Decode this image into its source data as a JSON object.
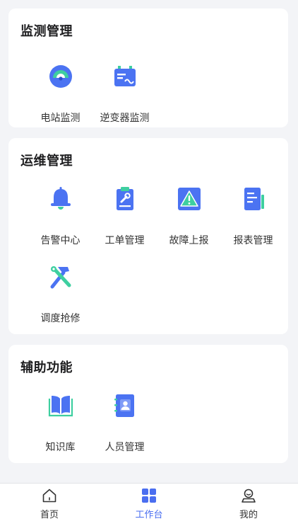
{
  "sections": [
    {
      "title": "监测管理",
      "items": [
        {
          "label": "电站监测",
          "icon": "gauge-icon"
        },
        {
          "label": "逆变器监测",
          "icon": "inverter-icon"
        }
      ]
    },
    {
      "title": "运维管理",
      "items": [
        {
          "label": "告警中心",
          "icon": "bell-icon"
        },
        {
          "label": "工单管理",
          "icon": "clipboard-wrench-icon"
        },
        {
          "label": "故障上报",
          "icon": "warning-icon"
        },
        {
          "label": "报表管理",
          "icon": "report-icon"
        },
        {
          "label": "调度抢修",
          "icon": "tools-icon"
        }
      ]
    },
    {
      "title": "辅助功能",
      "items": [
        {
          "label": "知识库",
          "icon": "book-icon"
        },
        {
          "label": "人员管理",
          "icon": "contacts-icon"
        }
      ]
    }
  ],
  "tabbar": [
    {
      "label": "首页",
      "icon": "home-icon",
      "active": false
    },
    {
      "label": "工作台",
      "icon": "workbench-icon",
      "active": true
    },
    {
      "label": "我的",
      "icon": "user-icon",
      "active": false
    }
  ],
  "colors": {
    "accent": "#4a6ef0",
    "icon_blue": "#4b73f2",
    "icon_green": "#3ecfa0",
    "background": "#f3f4f7"
  }
}
